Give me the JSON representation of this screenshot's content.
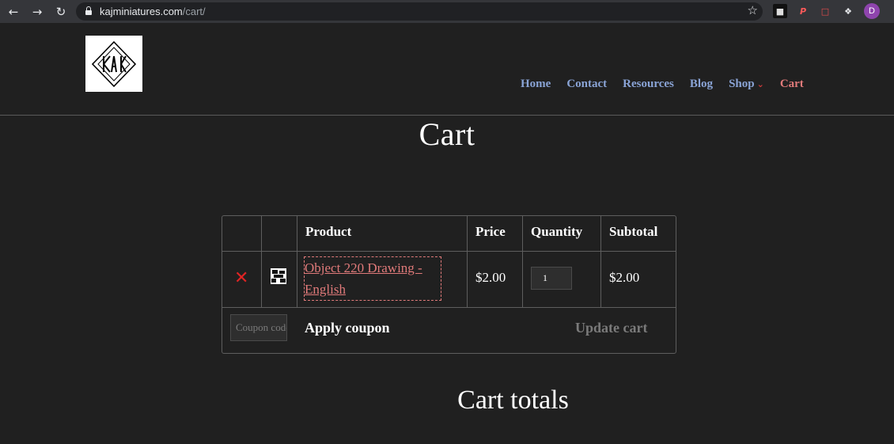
{
  "browser": {
    "url_host": "kajminiatures.com",
    "url_path": "/cart/",
    "profile_initial": "D"
  },
  "nav": {
    "items": [
      {
        "label": "Home"
      },
      {
        "label": "Contact"
      },
      {
        "label": "Resources"
      },
      {
        "label": "Blog"
      },
      {
        "label": "Shop"
      },
      {
        "label": "Cart"
      }
    ]
  },
  "page": {
    "title": "Cart",
    "totals_title": "Cart totals"
  },
  "cart": {
    "headers": {
      "product": "Product",
      "price": "Price",
      "quantity": "Quantity",
      "subtotal": "Subtotal"
    },
    "items": [
      {
        "product": "Object 220 Drawing - English",
        "price": "$2.00",
        "quantity": "1",
        "subtotal": "$2.00"
      }
    ],
    "coupon_placeholder": "Coupon code",
    "apply_label": "Apply coupon",
    "update_label": "Update cart"
  },
  "colors": {
    "background": "#202020",
    "nav_link": "#8aa4d6",
    "accent_link": "#e07a7a",
    "remove": "#e02424"
  },
  "icons": [
    "back-arrow-icon",
    "forward-arrow-icon",
    "reload-icon",
    "lock-icon",
    "star-icon",
    "extensions-puzzle-icon",
    "remove-x-icon",
    "chevron-down-icon"
  ]
}
